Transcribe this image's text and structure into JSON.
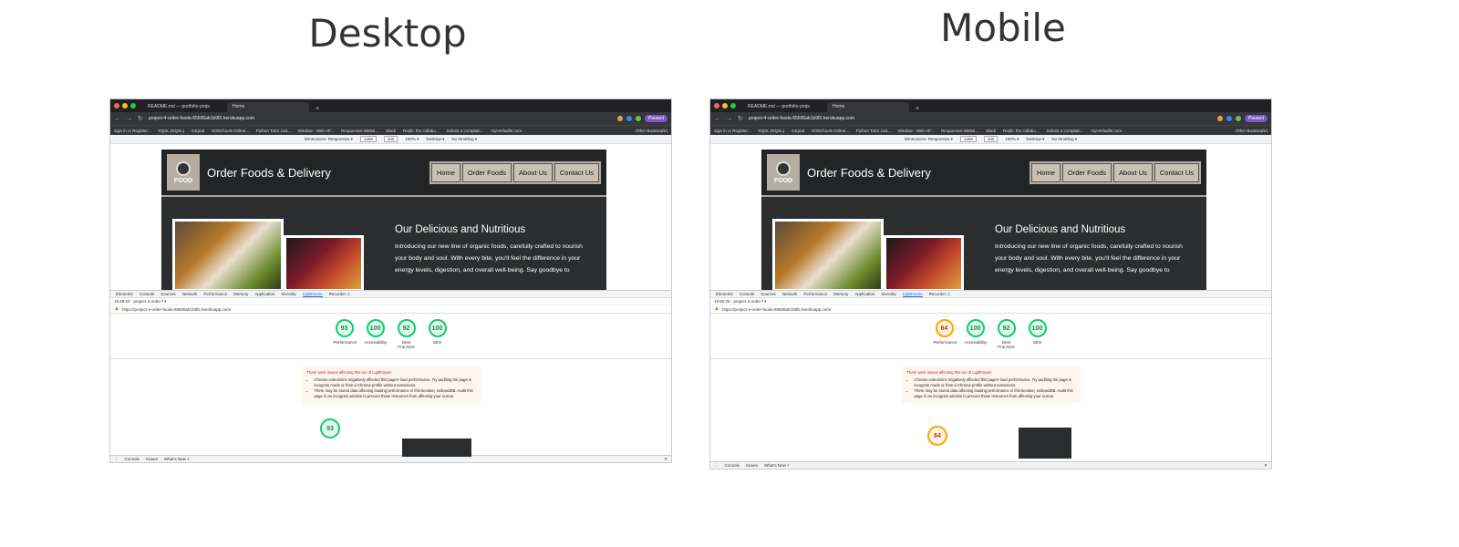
{
  "headings": {
    "desktop": "Desktop",
    "mobile": "Mobile"
  },
  "browser": {
    "tabs": [
      "README.md — portfolio-proje",
      "Home"
    ],
    "url": "project-4-order-foods-65605ab1b9f2.herokuapp.com",
    "paused": "Paused",
    "bookmarks": [
      "Sign in or Register...",
      "RQSL (RQSL)",
      "GKpod",
      "W3Schools Online...",
      "Python Tutor cod...",
      "Window - Web AP...",
      "Responsive Websi...",
      "Slack",
      "Replit: the collabo...",
      "Submit a complain...",
      "myHerbalife.com"
    ],
    "other_bookmarks": "Other Bookmarks"
  },
  "device_toolbar": {
    "dimensions": "Dimensions: Responsive ▾",
    "width": "1399",
    "height": "400",
    "zoom": "100% ▾",
    "device": "Desktop ▾",
    "throttle": "No throttling ▾"
  },
  "site": {
    "logo_text": "FOOD",
    "title": "Order Foods & Delivery",
    "nav": [
      "Home",
      "Order Foods",
      "About Us",
      "Contact Us"
    ],
    "hero_title": "Our Delicious and Nutritious",
    "hero_text": "Introducing our new line of organic foods, carefully crafted to nourish your body and soul. With every bite, you'll feel the difference in your energy levels, digestion, and overall well-being. Say goodbye to"
  },
  "devtools": {
    "tabs": [
      "Elements",
      "Console",
      "Sources",
      "Network",
      "Performance",
      "Memory",
      "Application",
      "Security",
      "Lighthouse",
      "Recorder ⚠"
    ],
    "active_tab": "Lighthouse",
    "report_url": "https://project-4-order-foods-65605ab1b9f2.herokuapp.com/",
    "drawer_tabs": [
      "Console",
      "Issues",
      "What's New ×"
    ]
  },
  "desktop": {
    "timestamp": "19:48:54 - project-4-order-f ▾",
    "scores": [
      {
        "value": "93",
        "label": "Performance",
        "rating": "good"
      },
      {
        "value": "100",
        "label": "Accessibility",
        "rating": "good"
      },
      {
        "value": "92",
        "label": "Best Practices",
        "rating": "good"
      },
      {
        "value": "100",
        "label": "SEO",
        "rating": "good"
      }
    ],
    "big_score": "93"
  },
  "mobile": {
    "timestamp": "19:50:25 - project-4-order-f ▾",
    "scores": [
      {
        "value": "64",
        "label": "Performance",
        "rating": "average"
      },
      {
        "value": "100",
        "label": "Accessibility",
        "rating": "good"
      },
      {
        "value": "92",
        "label": "Best Practices",
        "rating": "good"
      },
      {
        "value": "100",
        "label": "SEO",
        "rating": "good"
      }
    ],
    "big_score": "64"
  },
  "warning": {
    "title": "There were issues affecting this run of Lighthouse:",
    "items": [
      "Chrome extensions negatively affected this page's load performance. Try auditing the page in incognito mode or from a Chrome profile without extensions.",
      "There may be stored data affecting loading performance in this location: IndexedDB. Audit this page in an incognito window to prevent those resources from affecting your scores."
    ]
  },
  "colors": {
    "good": "#0cce6b",
    "average": "#ffa400",
    "site_bg": "#2b2d2e",
    "nav_bg": "#b5ada1"
  }
}
